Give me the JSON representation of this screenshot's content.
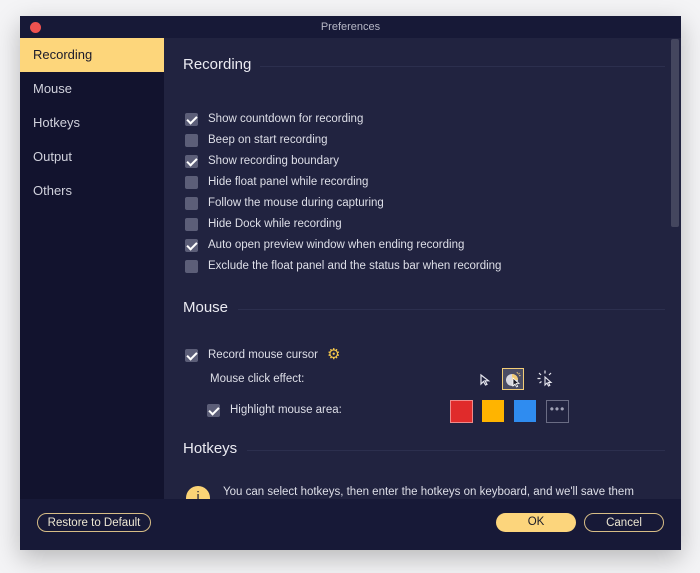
{
  "window": {
    "title": "Preferences"
  },
  "sidebar": {
    "items": [
      {
        "label": "Recording",
        "active": true
      },
      {
        "label": "Mouse",
        "active": false
      },
      {
        "label": "Hotkeys",
        "active": false
      },
      {
        "label": "Output",
        "active": false
      },
      {
        "label": "Others",
        "active": false
      }
    ]
  },
  "recording": {
    "title": "Recording",
    "options": [
      {
        "label": "Show countdown for recording",
        "checked": true
      },
      {
        "label": "Beep on start recording",
        "checked": false
      },
      {
        "label": "Show recording boundary",
        "checked": true
      },
      {
        "label": "Hide float panel while recording",
        "checked": false
      },
      {
        "label": "Follow the mouse during capturing",
        "checked": false
      },
      {
        "label": "Hide Dock while recording",
        "checked": false
      },
      {
        "label": "Auto open preview window when ending recording",
        "checked": true
      },
      {
        "label": "Exclude the float panel and the status bar when recording",
        "checked": false
      }
    ]
  },
  "mouse": {
    "title": "Mouse",
    "record_cursor": {
      "label": "Record mouse cursor",
      "checked": true,
      "icon": "gear-icon"
    },
    "click_effect": {
      "label": "Mouse click effect:",
      "options": [
        {
          "icon": "cursor-plain-icon",
          "selected": false
        },
        {
          "icon": "cursor-highlight-icon",
          "selected": true
        },
        {
          "icon": "cursor-burst-icon",
          "selected": false
        }
      ]
    },
    "highlight_area": {
      "label": "Highlight mouse area:",
      "checked": true,
      "colors": [
        "#e02b2b",
        "#ffb400",
        "#2f8cf0"
      ],
      "more_label": "•••"
    }
  },
  "hotkeys": {
    "title": "Hotkeys",
    "info_icon": "i",
    "info_text": "You can select hotkeys, then enter the hotkeys on keyboard, and we'll save them automatically."
  },
  "footer": {
    "restore_label": "Restore to Default",
    "ok_label": "OK",
    "cancel_label": "Cancel"
  },
  "colors": {
    "accent": "#fcd57c",
    "close": "#f0524f"
  }
}
